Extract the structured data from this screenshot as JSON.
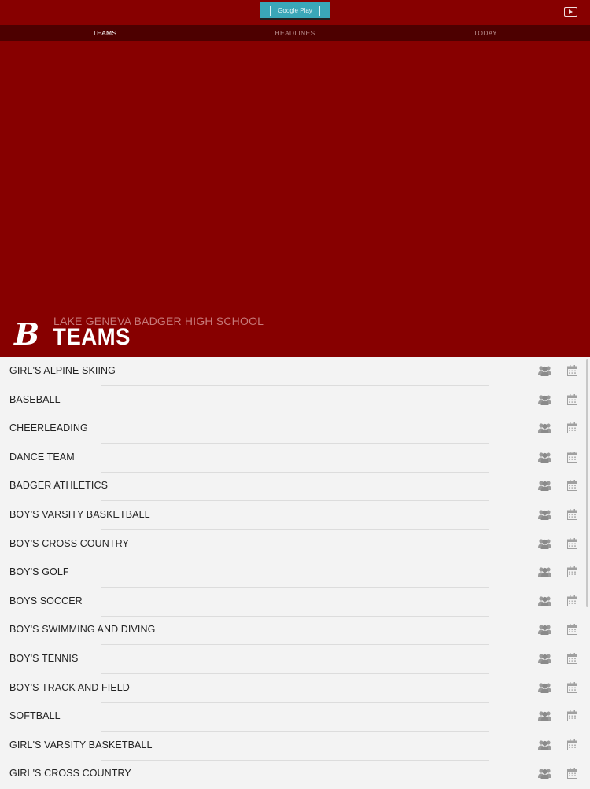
{
  "top_bar": {
    "badge_label": "Google Play"
  },
  "tabs": [
    {
      "label": "TEAMS",
      "active": true
    },
    {
      "label": "HEADLINES",
      "active": false
    },
    {
      "label": "TODAY",
      "active": false
    }
  ],
  "hero": {
    "logo_letter": "B",
    "school_name": "LAKE GENEVA BADGER HIGH SCHOOL",
    "title": "TEAMS"
  },
  "teams": [
    {
      "label": "GIRL'S ALPINE SKIING"
    },
    {
      "label": "BASEBALL"
    },
    {
      "label": "CHEERLEADING"
    },
    {
      "label": "DANCE TEAM"
    },
    {
      "label": "BADGER ATHLETICS"
    },
    {
      "label": "BOY'S VARSITY BASKETBALL"
    },
    {
      "label": "BOY'S CROSS COUNTRY"
    },
    {
      "label": "BOY'S GOLF"
    },
    {
      "label": "BOYS SOCCER"
    },
    {
      "label": "BOY'S SWIMMING AND DIVING"
    },
    {
      "label": "BOY'S TENNIS"
    },
    {
      "label": "BOY'S TRACK AND FIELD"
    },
    {
      "label": "SOFTBALL"
    },
    {
      "label": "GIRL'S VARSITY BASKETBALL"
    },
    {
      "label": "GIRL'S CROSS COUNTRY"
    }
  ],
  "colors": {
    "brand": "#870000",
    "tab_bar": "#4d0000",
    "list_bg": "#f3f3f3",
    "icon_gray": "#9a9a9a"
  },
  "icons": {
    "row_action_1": "roster-icon",
    "row_action_2": "calendar-icon",
    "top_right": "video-icon"
  }
}
